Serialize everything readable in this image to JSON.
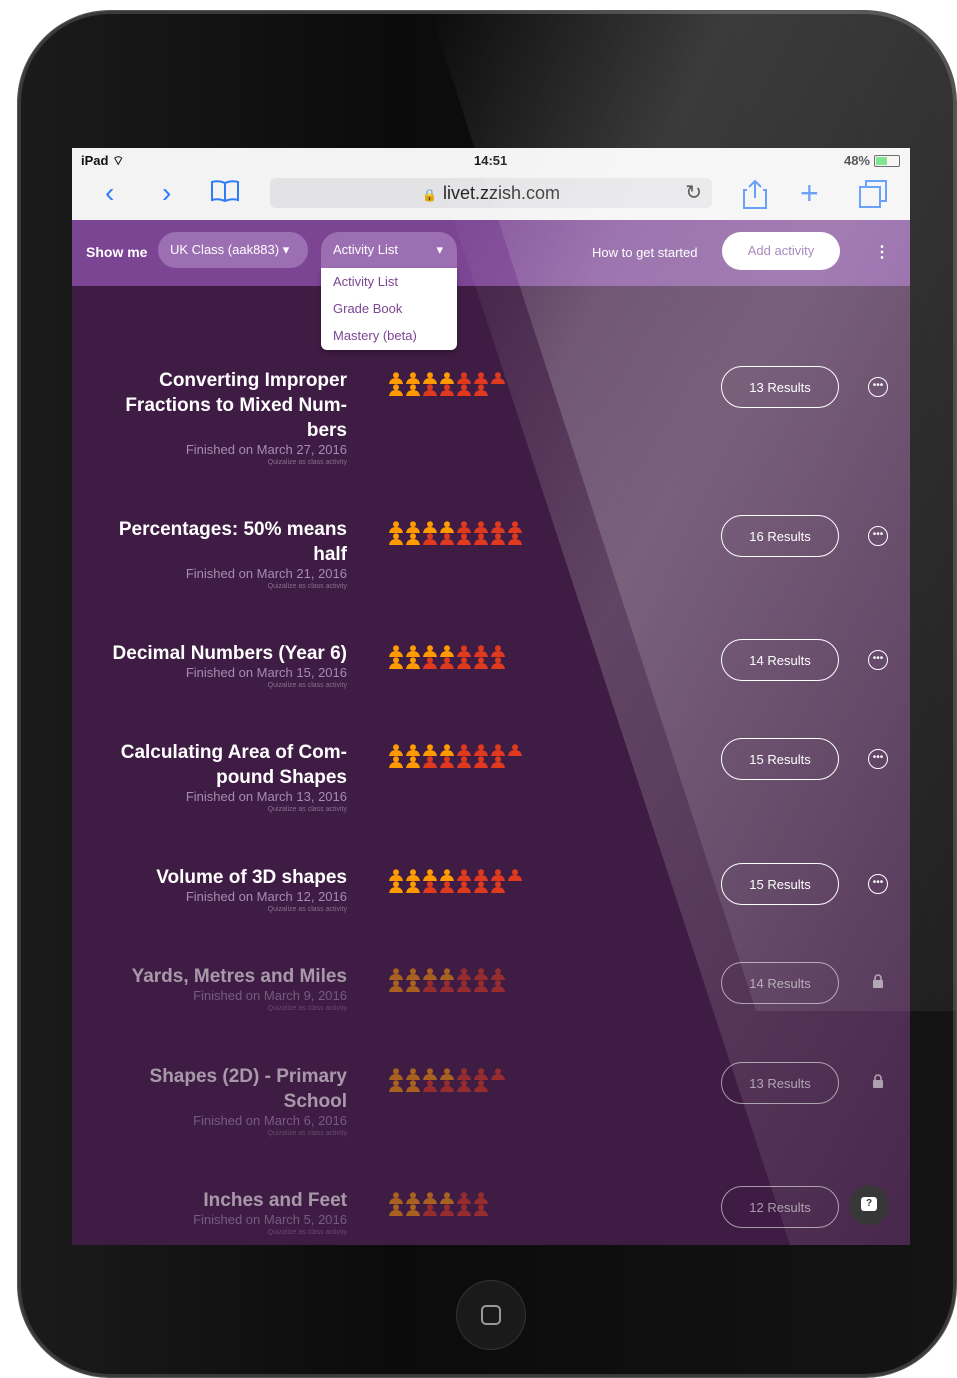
{
  "status_bar": {
    "device": "iPad",
    "wifi_icon": "wifi-icon",
    "time": "14:51",
    "battery": "48%",
    "battery_level": 0.48
  },
  "browser": {
    "back_icon": "chevron-left-icon",
    "forward_icon": "chevron-right-icon",
    "bookmarks_icon": "book-icon",
    "url": "livet.zzish.com",
    "reload_icon": "reload-icon",
    "share_icon": "share-icon",
    "new_tab_icon": "plus-icon",
    "tabs_icon": "tabs-icon"
  },
  "header": {
    "show_me": "Show me",
    "class_select": "UK Class (aak883)",
    "view_select": "Activity List",
    "how_to": "How to get started",
    "add_activity": "Add activity",
    "menu_icon": "kebab-icon"
  },
  "dropdown": {
    "options": [
      "Activity List",
      "Grade Book",
      "Mastery (beta)"
    ]
  },
  "activities": [
    {
      "title": "Converting Improper Fractions to Mixed Num-bers",
      "finished": "Finished on March 27, 2016",
      "sub": "Quizalize as class activity",
      "results": "13 Results",
      "students": 13,
      "locked": false
    },
    {
      "title": "Percentages: 50% means half",
      "finished": "Finished on March 21, 2016",
      "sub": "Quizalize as class activity",
      "results": "16 Results",
      "students": 16,
      "locked": false
    },
    {
      "title": "Decimal Numbers (Year 6)",
      "finished": "Finished on March 15, 2016",
      "sub": "Quizalize as class activity",
      "results": "14 Results",
      "students": 14,
      "locked": false
    },
    {
      "title": "Calculating Area of Com-pound Shapes",
      "finished": "Finished on March 13, 2016",
      "sub": "Quizalize as class activity",
      "results": "15 Results",
      "students": 15,
      "locked": false
    },
    {
      "title": "Volume of 3D shapes",
      "finished": "Finished on March 12, 2016",
      "sub": "Quizalize as class activity",
      "results": "15 Results",
      "students": 15,
      "locked": false
    },
    {
      "title": "Yards, Metres and Miles",
      "finished": "Finished on March 9, 2016",
      "sub": "Quizalize as class activity",
      "results": "14 Results",
      "students": 14,
      "locked": true
    },
    {
      "title": "Shapes (2D) - Primary School",
      "finished": "Finished on March 6, 2016",
      "sub": "Quizalize as class activity",
      "results": "13 Results",
      "students": 13,
      "locked": true
    },
    {
      "title": "Inches and Feet",
      "finished": "Finished on March 5, 2016",
      "sub": "Quizalize as class activity",
      "results": "12 Results",
      "students": 12,
      "locked": true
    }
  ],
  "chat_icon": "chat-help-icon",
  "home_button_icon": "home-button-icon",
  "colors": {
    "header": "#7b4593",
    "background": "#3f1c43",
    "student_good": "#ff9a00",
    "student_bad": "#e03a1e"
  }
}
